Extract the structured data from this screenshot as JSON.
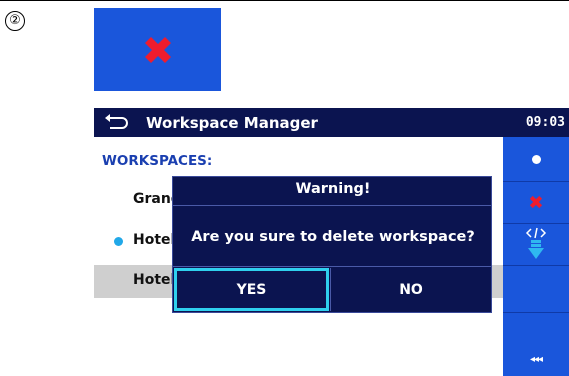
{
  "step_marker": "②",
  "window": {
    "title": "Workspace Manager",
    "time": "09:03"
  },
  "workspaces": {
    "heading": "WORKSPACES:",
    "items": [
      {
        "label": "Grand Hotel",
        "active": false,
        "selected": false
      },
      {
        "label": "Hotel",
        "active": true,
        "selected": false
      },
      {
        "label": "Hotel",
        "active": false,
        "selected": true
      }
    ]
  },
  "sidebar": {
    "buttons": [
      {
        "icon": "dot-icon"
      },
      {
        "icon": "delete-icon"
      },
      {
        "icon": "export-icon"
      }
    ],
    "collapse_label": "◂◂◂"
  },
  "dialog": {
    "title": "Warning!",
    "message": "Are you sure to delete workspace?",
    "yes_label": "YES",
    "no_label": "NO"
  },
  "colors": {
    "titlebar": "#0b1450",
    "sidebar": "#1a56db",
    "heading": "#1a3fb0",
    "focus": "#2fd0ee",
    "delete": "#ee1c2e",
    "export": "#2fb8f0"
  }
}
